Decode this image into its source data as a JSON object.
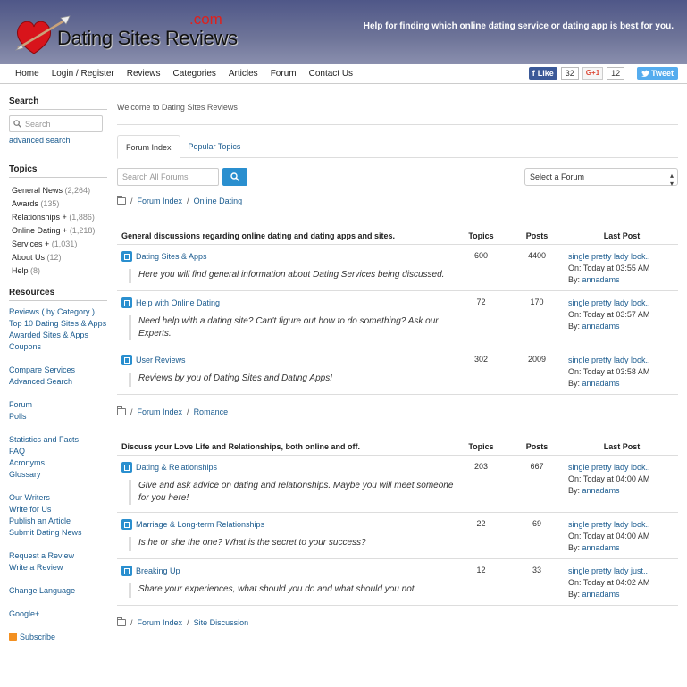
{
  "header": {
    "logo_text": "Dating Sites Reviews",
    "logo_com": ".com",
    "tagline": "Help for finding which online dating service or dating app is best for you."
  },
  "nav": {
    "items": [
      "Home",
      "Login / Register",
      "Reviews",
      "Categories",
      "Articles",
      "Forum",
      "Contact Us"
    ]
  },
  "social": {
    "like_label": "Like",
    "like_count": "32",
    "gplus_label": "G+1",
    "gplus_count": "12",
    "tweet_label": "Tweet"
  },
  "sidebar": {
    "search_heading": "Search",
    "search_placeholder": "Search",
    "advanced_search": "advanced search",
    "topics_heading": "Topics",
    "topics": [
      {
        "label": "General News",
        "count": "(2,264)"
      },
      {
        "label": "Awards",
        "count": "(135)"
      },
      {
        "label": "Relationships +",
        "count": "(1,886)"
      },
      {
        "label": "Online Dating +",
        "count": "(1,218)"
      },
      {
        "label": "Services +",
        "count": "(1,031)"
      },
      {
        "label": "About Us",
        "count": "(12)"
      },
      {
        "label": "Help",
        "count": "(8)"
      }
    ],
    "resources_heading": "Resources",
    "resources": [
      "Reviews ( by Category )",
      "Top 10 Dating Sites & Apps",
      "Awarded Sites & Apps",
      "Coupons",
      "",
      "Compare Services",
      "Advanced Search",
      "",
      "Forum",
      "Polls",
      "",
      "Statistics and Facts",
      "FAQ",
      "Acronyms",
      "Glossary",
      "",
      "Our Writers",
      "Write for Us",
      "Publish an Article",
      "Submit Dating News",
      "",
      "Request a Review",
      "Write a Review",
      "",
      "Change Language",
      "",
      "Google+",
      "",
      "Subscribe"
    ]
  },
  "main": {
    "welcome": "Welcome to Dating Sites Reviews",
    "tabs": [
      "Forum Index",
      "Popular Topics"
    ],
    "forum_search_placeholder": "Search All Forums",
    "select_forum": "Select a Forum",
    "crumb_root": "Forum Index",
    "categories": [
      {
        "crumb": "Online Dating",
        "description": "General discussions regarding online dating and dating apps and sites.",
        "col_topics": "Topics",
        "col_posts": "Posts",
        "col_last": "Last Post",
        "forums": [
          {
            "name": "Dating Sites & Apps",
            "desc": "Here you will find general information about Dating Services being discussed.",
            "topics": "600",
            "posts": "4400",
            "last_title": "single pretty lady look..",
            "last_on": "On: Today at 03:55 AM",
            "last_by_label": "By:",
            "last_by": "annadams"
          },
          {
            "name": "Help with Online Dating",
            "desc": "Need help with a dating site? Can't figure out how to do something? Ask our Experts.",
            "topics": "72",
            "posts": "170",
            "last_title": "single pretty lady look..",
            "last_on": "On: Today at 03:57 AM",
            "last_by_label": "By:",
            "last_by": "annadams"
          },
          {
            "name": "User Reviews",
            "desc": "Reviews by you of Dating Sites and Dating Apps!",
            "topics": "302",
            "posts": "2009",
            "last_title": "single pretty lady look..",
            "last_on": "On: Today at 03:58 AM",
            "last_by_label": "By:",
            "last_by": "annadams"
          }
        ]
      },
      {
        "crumb": "Romance",
        "description": "Discuss your Love Life and Relationships, both online and off.",
        "col_topics": "Topics",
        "col_posts": "Posts",
        "col_last": "Last Post",
        "forums": [
          {
            "name": "Dating & Relationships",
            "desc": "Give and ask advice on dating and relationships. Maybe you will meet someone for you here!",
            "topics": "203",
            "posts": "667",
            "last_title": "single pretty lady look..",
            "last_on": "On: Today at 04:00 AM",
            "last_by_label": "By:",
            "last_by": "annadams"
          },
          {
            "name": "Marriage & Long-term Relationships",
            "desc": "Is he or she the one? What is the secret to your success?",
            "topics": "22",
            "posts": "69",
            "last_title": "single pretty lady look..",
            "last_on": "On: Today at 04:00 AM",
            "last_by_label": "By:",
            "last_by": "annadams"
          },
          {
            "name": "Breaking Up",
            "desc": "Share your experiences, what should you do and what should you not.",
            "topics": "12",
            "posts": "33",
            "last_title": "single pretty lady just..",
            "last_on": "On: Today at 04:02 AM",
            "last_by_label": "By:",
            "last_by": "annadams"
          }
        ]
      }
    ],
    "last_crumb": "Site Discussion"
  }
}
